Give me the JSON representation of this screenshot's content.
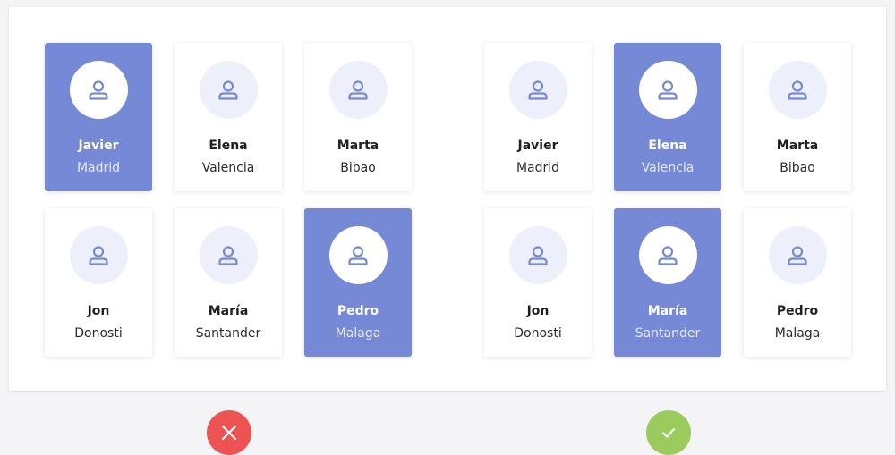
{
  "colors": {
    "selected": "#7689d6",
    "card": "#ffffff",
    "avatar_bg": "#edf0fb",
    "icon": "#7689d6",
    "wrong": "#ec5352",
    "correct": "#9bcb5c"
  },
  "examples": [
    {
      "verdict": "incorrect",
      "badge_icon": "close-icon",
      "cards": [
        {
          "name": "Javier",
          "city": "Madrid",
          "selected": true
        },
        {
          "name": "Elena",
          "city": "Valencia",
          "selected": false
        },
        {
          "name": "Marta",
          "city": "Bibao",
          "selected": false
        },
        {
          "name": "Jon",
          "city": "Donosti",
          "selected": false
        },
        {
          "name": "María",
          "city": "Santander",
          "selected": false
        },
        {
          "name": "Pedro",
          "city": "Malaga",
          "selected": true
        }
      ]
    },
    {
      "verdict": "correct",
      "badge_icon": "check-icon",
      "cards": [
        {
          "name": "Javier",
          "city": "Madrid",
          "selected": false
        },
        {
          "name": "Elena",
          "city": "Valencia",
          "selected": true
        },
        {
          "name": "Marta",
          "city": "Bibao",
          "selected": false
        },
        {
          "name": "Jon",
          "city": "Donosti",
          "selected": false
        },
        {
          "name": "María",
          "city": "Santander",
          "selected": true
        },
        {
          "name": "Pedro",
          "city": "Malaga",
          "selected": false
        }
      ]
    }
  ]
}
